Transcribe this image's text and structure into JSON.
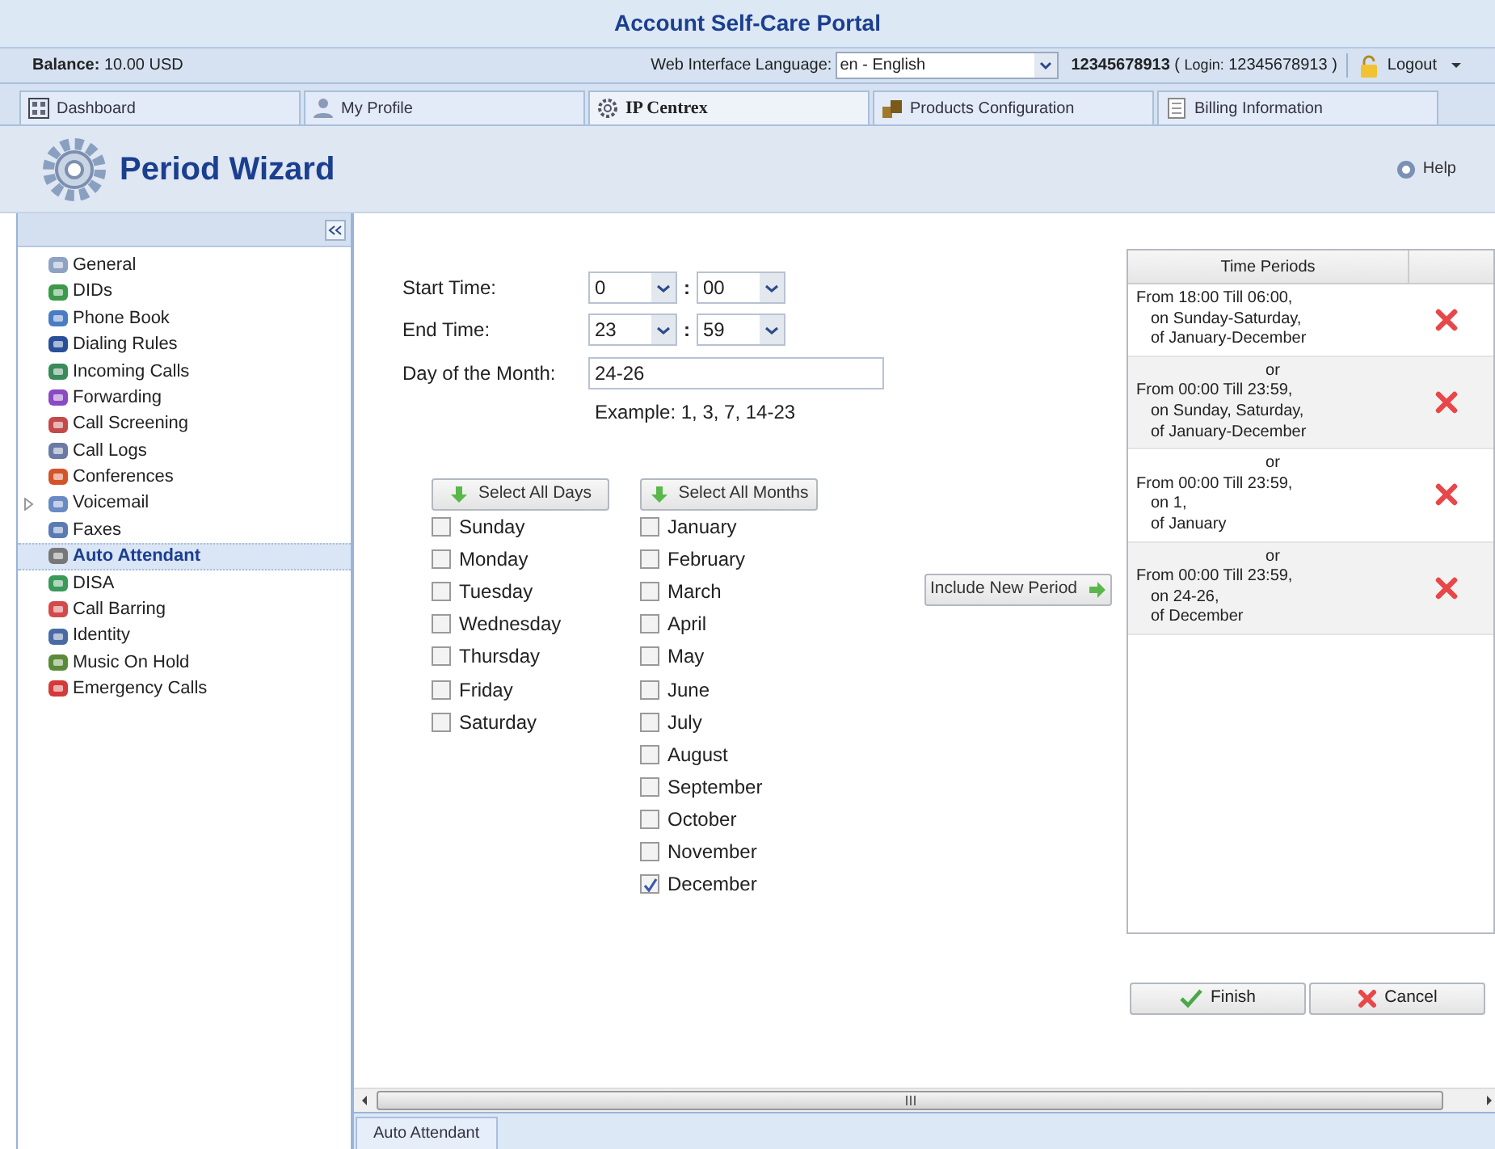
{
  "portal_title": "Account Self-Care Portal",
  "balance": {
    "label": "Balance:",
    "value": "10.00 USD"
  },
  "language": {
    "label": "Web Interface Language:",
    "value": "en - English"
  },
  "account": {
    "number": "12345678913",
    "login_open": "(",
    "login_label": "Login:",
    "login": "12345678913",
    "login_close": ")"
  },
  "logout": "Logout",
  "tabs": [
    {
      "label": "Dashboard",
      "selected": false
    },
    {
      "label": "My Profile",
      "selected": false
    },
    {
      "label": "IP Centrex",
      "selected": true
    },
    {
      "label": "Products Configuration",
      "selected": false
    },
    {
      "label": "Billing Information",
      "selected": false
    }
  ],
  "page_title": "Period Wizard",
  "help": "Help",
  "sidebar": {
    "items": [
      {
        "label": "General",
        "kind": "item",
        "selected": false
      },
      {
        "label": "DIDs",
        "kind": "item",
        "selected": false
      },
      {
        "label": "Phone Book",
        "kind": "item",
        "selected": false
      },
      {
        "label": "Dialing Rules",
        "kind": "item",
        "selected": false
      },
      {
        "label": "Incoming Calls",
        "kind": "item",
        "selected": false
      },
      {
        "label": "Forwarding",
        "kind": "item",
        "selected": false
      },
      {
        "label": "Call Screening",
        "kind": "item",
        "selected": false
      },
      {
        "label": "Call Logs",
        "kind": "item",
        "selected": false
      },
      {
        "label": "Conferences",
        "kind": "item",
        "selected": false
      },
      {
        "label": "Voicemail",
        "kind": "group",
        "selected": false
      },
      {
        "label": "Faxes",
        "kind": "item",
        "selected": false
      },
      {
        "label": "Auto Attendant",
        "kind": "item",
        "selected": true
      },
      {
        "label": "DISA",
        "kind": "item",
        "selected": false
      },
      {
        "label": "Call Barring",
        "kind": "item",
        "selected": false
      },
      {
        "label": "Identity",
        "kind": "item",
        "selected": false
      },
      {
        "label": "Music On Hold",
        "kind": "item",
        "selected": false
      },
      {
        "label": "Emergency Calls",
        "kind": "item",
        "selected": false
      }
    ]
  },
  "form": {
    "start_label": "Start Time:",
    "start_hour": "0",
    "start_minute": "00",
    "colon": ":",
    "end_label": "End Time:",
    "end_hour": "23",
    "end_minute": "59",
    "day_label": "Day of the Month:",
    "day_value": "24-26",
    "example": "Example: 1, 3, 7, 14-23"
  },
  "select_all_days": "Select All Days",
  "select_all_months": "Select All Months",
  "days": [
    {
      "label": "Sunday",
      "checked": false
    },
    {
      "label": "Monday",
      "checked": false
    },
    {
      "label": "Tuesday",
      "checked": false
    },
    {
      "label": "Wednesday",
      "checked": false
    },
    {
      "label": "Thursday",
      "checked": false
    },
    {
      "label": "Friday",
      "checked": false
    },
    {
      "label": "Saturday",
      "checked": false
    }
  ],
  "months": [
    {
      "label": "January",
      "checked": false
    },
    {
      "label": "February",
      "checked": false
    },
    {
      "label": "March",
      "checked": false
    },
    {
      "label": "April",
      "checked": false
    },
    {
      "label": "May",
      "checked": false
    },
    {
      "label": "June",
      "checked": false
    },
    {
      "label": "July",
      "checked": false
    },
    {
      "label": "August",
      "checked": false
    },
    {
      "label": "September",
      "checked": false
    },
    {
      "label": "October",
      "checked": false
    },
    {
      "label": "November",
      "checked": false
    },
    {
      "label": "December",
      "checked": true
    }
  ],
  "include_button": "Include New Period",
  "time_periods": {
    "column_1": "Time Periods",
    "rows": [
      {
        "lines": [
          "From 18:00 Till 06:00,",
          "on Sunday-Saturday,",
          "of January-December"
        ]
      },
      {
        "or": "or",
        "lines": [
          "From 00:00 Till 23:59,",
          "on Sunday, Saturday,",
          "of January-December"
        ]
      },
      {
        "or": "or",
        "lines": [
          "From 00:00 Till 23:59,",
          "on 1,",
          "of January"
        ]
      },
      {
        "or": "or",
        "lines": [
          "From 00:00 Till 23:59,",
          "on 24-26,",
          "of December"
        ]
      }
    ]
  },
  "finish": "Finish",
  "cancel": "Cancel",
  "bottom_tab": "Auto Attendant"
}
